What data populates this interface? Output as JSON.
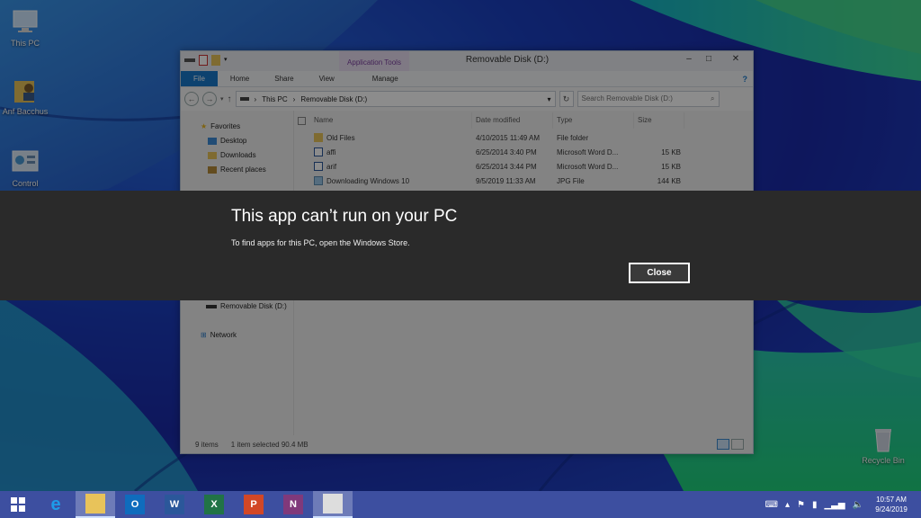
{
  "desktop": {
    "icons": [
      {
        "label": "This PC"
      },
      {
        "label": "Anf Bacchus"
      },
      {
        "label": "Control"
      },
      {
        "label": "Recycle Bin"
      }
    ]
  },
  "window": {
    "title": "Removable Disk (D:)",
    "context_tab_group": "Application Tools",
    "ribbon_tabs": [
      "File",
      "Home",
      "Share",
      "View",
      "Manage"
    ],
    "address": {
      "segments": [
        "This PC",
        "Removable Disk (D:)"
      ]
    },
    "search_placeholder": "Search Removable Disk (D:)",
    "nav": {
      "favorites_label": "Favorites",
      "favorites": [
        "Desktop",
        "Downloads",
        "Recent places"
      ],
      "drive_label": "Removable Disk (D:)",
      "network_label": "Network"
    },
    "columns": {
      "name": "Name",
      "date": "Date modified",
      "type": "Type",
      "size": "Size"
    },
    "files": [
      {
        "name": "Old Files",
        "date": "4/10/2015 11:49 AM",
        "type": "File folder",
        "size": "",
        "icon": "folder-icon"
      },
      {
        "name": "affi",
        "date": "6/25/2014 3:40 PM",
        "type": "Microsoft Word D...",
        "size": "15 KB",
        "icon": "word-doc-icon"
      },
      {
        "name": "arif",
        "date": "6/25/2014 3:44 PM",
        "type": "Microsoft Word D...",
        "size": "15 KB",
        "icon": "word-doc-icon"
      },
      {
        "name": "Downloading Windows 10",
        "date": "9/5/2019 11:33 AM",
        "type": "JPG File",
        "size": "144 KB",
        "icon": "image-icon"
      }
    ],
    "status": {
      "items": "9 items",
      "selection": "1 item selected  90.4 MB"
    }
  },
  "dialog": {
    "title": "This app can’t run on your PC",
    "message": "To find apps for this PC, open the Windows Store.",
    "close_label": "Close"
  },
  "taskbar": {
    "apps": [
      {
        "name": "internet-explorer",
        "glyph": "e",
        "color": "#1e9be8"
      },
      {
        "name": "file-explorer",
        "glyph": "",
        "color": "#e8c35a"
      },
      {
        "name": "outlook",
        "glyph": "O",
        "color": "#0f6cbd"
      },
      {
        "name": "word",
        "glyph": "W",
        "color": "#2b579a"
      },
      {
        "name": "excel",
        "glyph": "X",
        "color": "#217346"
      },
      {
        "name": "powerpoint",
        "glyph": "P",
        "color": "#d24726"
      },
      {
        "name": "onenote",
        "glyph": "N",
        "color": "#80397b"
      },
      {
        "name": "app-package",
        "glyph": "",
        "color": "#dddddd"
      }
    ],
    "clock": {
      "time": "10:57 AM",
      "date": "9/24/2019"
    }
  }
}
